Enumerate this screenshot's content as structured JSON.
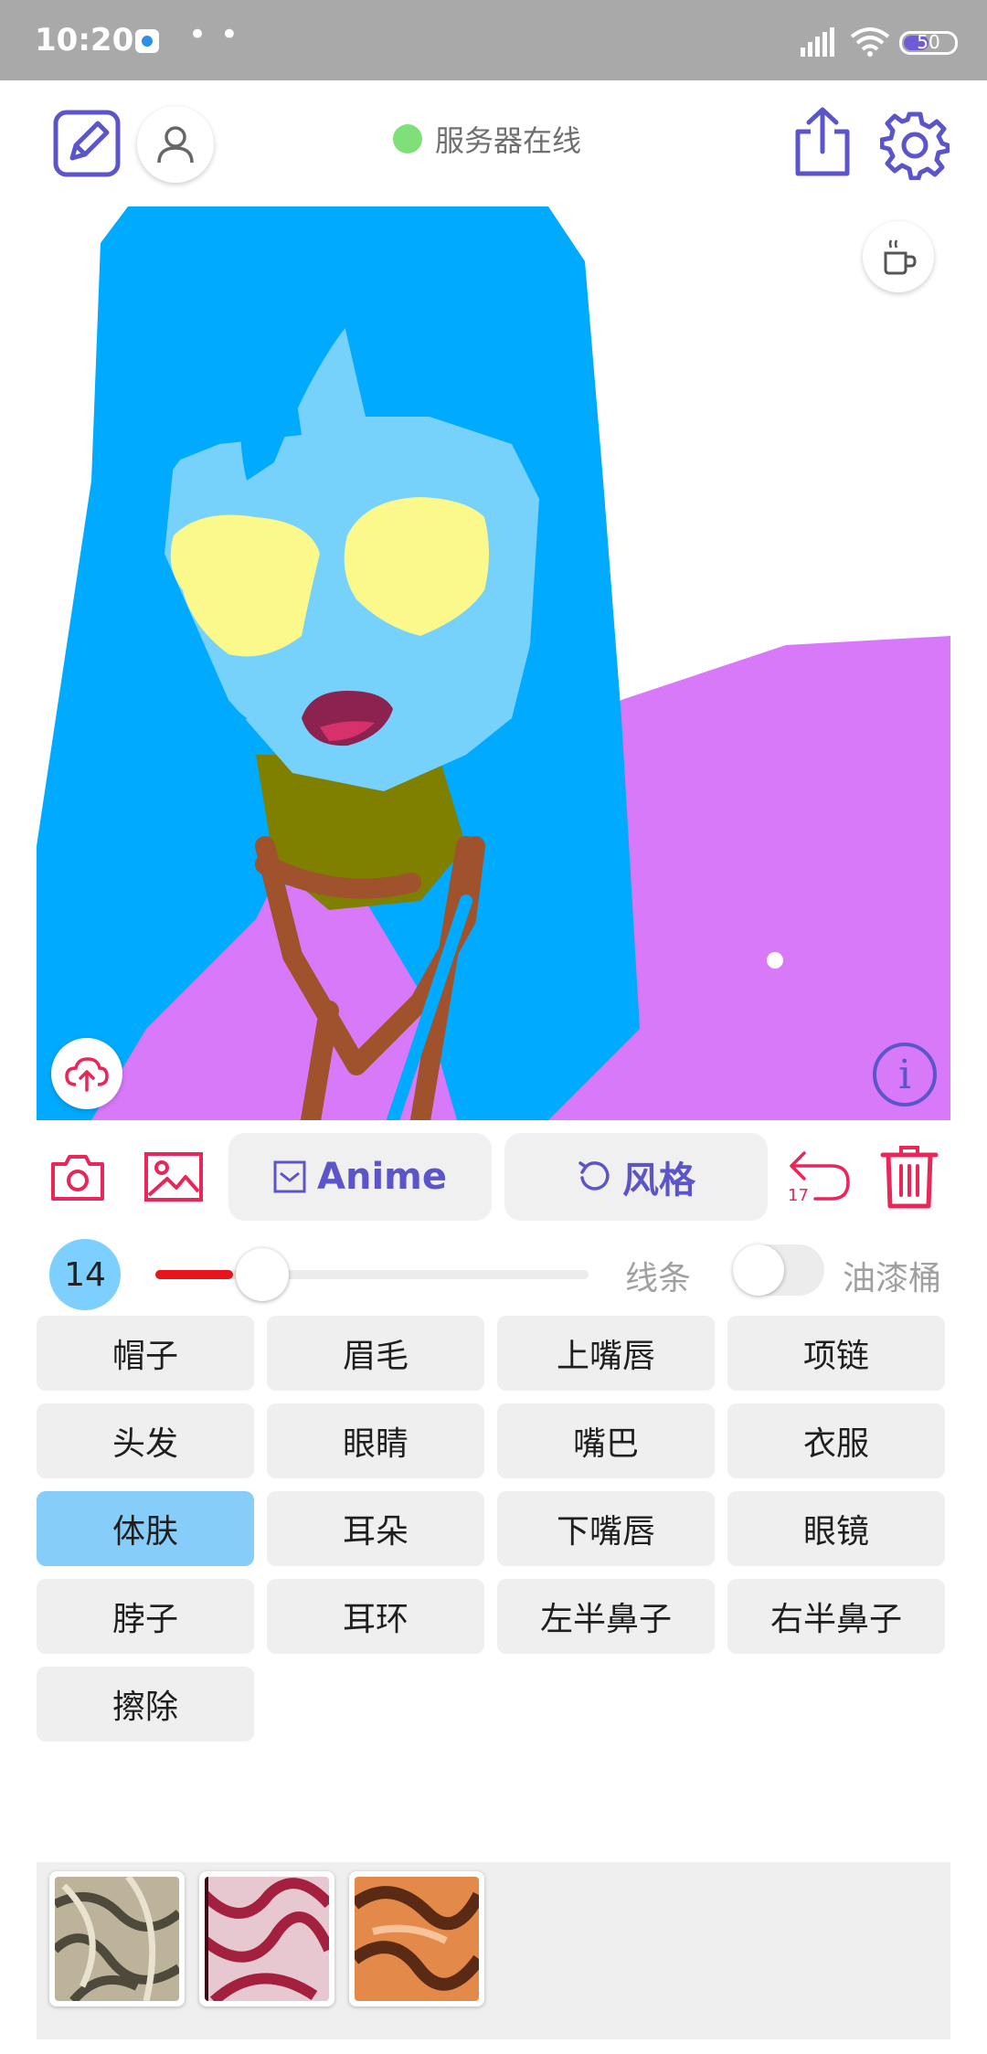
{
  "statusbar": {
    "time": "10:20",
    "more": "• •",
    "battery": "50",
    "battery_level_percent": 50
  },
  "header": {
    "server_status": "服务器在线",
    "server_status_color": "#7fe07a",
    "accent": "#5b55c9"
  },
  "toolbar": {
    "anime_label": "Anime",
    "style_label": "风格",
    "undo_count": "17",
    "icon_color": "#e8265a"
  },
  "brush": {
    "size": "14",
    "slider_level_fraction": 0.18,
    "line_label": "线条",
    "bucket_label": "油漆桶",
    "bucket_enabled": false
  },
  "labels": {
    "selected": "体肤",
    "items": [
      "帽子",
      "眉毛",
      "上嘴唇",
      "项链",
      "头发",
      "眼睛",
      "嘴巴",
      "衣服",
      "体肤",
      "耳朵",
      "下嘴唇",
      "眼镜",
      "脖子",
      "耳环",
      "左半鼻子",
      "右半鼻子",
      "擦除"
    ]
  },
  "style_presets": {
    "count": 3
  },
  "canvas_colors": {
    "hair": "#00aaff",
    "skin": "#76d2fa",
    "eyes": "#fbf98c",
    "neck": "#7f7f00",
    "clothes": "#d879fa",
    "necklace": "#a0522d",
    "mouth": "#8b2250"
  }
}
